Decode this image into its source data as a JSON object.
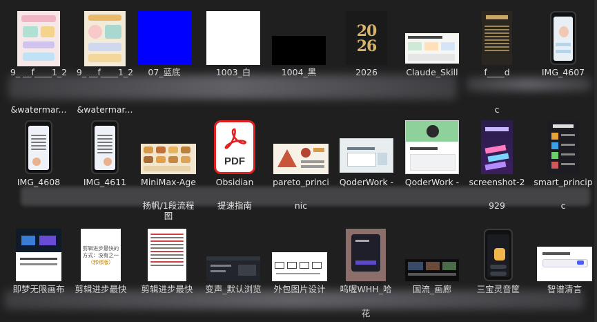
{
  "files": [
    {
      "name_lines": [
        "9_ __f____1_2",
        "&watermar..."
      ],
      "thumb": "infographic-pink"
    },
    {
      "name_lines": [
        "9_ __f____1_2",
        "&watermar..."
      ],
      "thumb": "infographic-beige"
    },
    {
      "name_lines": [
        "07_蓝底"
      ],
      "thumb": "solid-blue"
    },
    {
      "name_lines": [
        "1003_白"
      ],
      "thumb": "solid-white"
    },
    {
      "name_lines": [
        "1004_黑"
      ],
      "thumb": "solid-black"
    },
    {
      "name_lines": [
        "2026"
      ],
      "thumb": "gold-2026"
    },
    {
      "name_lines": [
        "Claude_Skill"
      ],
      "thumb": "slide-light"
    },
    {
      "name_lines": [
        "f____d",
        "c"
      ],
      "thumb": "poster-dark"
    },
    {
      "name_lines": [
        "IMG_4607"
      ],
      "thumb": "phone-screenshot"
    },
    {
      "name_lines": [
        "IMG_4608"
      ],
      "thumb": "phone-screenshot"
    },
    {
      "name_lines": [
        "IMG_4611"
      ],
      "thumb": "phone-screenshot"
    },
    {
      "name_lines": [
        "MiniMax-Age",
        "扬帆/1段流程",
        "图"
      ],
      "thumb": "food-grid"
    },
    {
      "name_lines": [
        "Obsidian",
        "提速指南"
      ],
      "thumb": "pdf"
    },
    {
      "name_lines": [
        "pareto_princi",
        "nic"
      ],
      "thumb": "infographic-pyramid"
    },
    {
      "name_lines": [
        "QoderWork -"
      ],
      "thumb": "app-window"
    },
    {
      "name_lines": [
        "QoderWork -"
      ],
      "thumb": "app-green"
    },
    {
      "name_lines": [
        "screenshot-2",
        "929"
      ],
      "thumb": "phone-purple"
    },
    {
      "name_lines": [
        "smart_princip",
        "c"
      ],
      "thumb": "smart-dark"
    },
    {
      "name_lines": [
        "即梦无限画布"
      ],
      "thumb": "dark-banner"
    },
    {
      "name_lines": [
        "剪辑进步最快"
      ],
      "thumb": "text-card"
    },
    {
      "name_lines": [
        "剪辑进步最快"
      ],
      "thumb": "text-doc"
    },
    {
      "name_lines": [
        "变声_默认浏览"
      ],
      "thumb": "dark-ui"
    },
    {
      "name_lines": [
        "外包图片设计"
      ],
      "thumb": "flow-light"
    },
    {
      "name_lines": [
        "呜喔WHH_哈",
        "花"
      ],
      "thumb": "photo-screen"
    },
    {
      "name_lines": [
        "国流_画廊"
      ],
      "thumb": "dark-collage"
    },
    {
      "name_lines": [
        "三宝灵音筐"
      ],
      "thumb": "phone-dark-app"
    },
    {
      "name_lines": [
        "智谱清言"
      ],
      "thumb": "chat-light"
    }
  ],
  "pdf_label": "PDF",
  "year_text": "2026",
  "card_text": [
    "剪辑进步最快的",
    "方式：没有之一",
    "（邪修版）"
  ]
}
